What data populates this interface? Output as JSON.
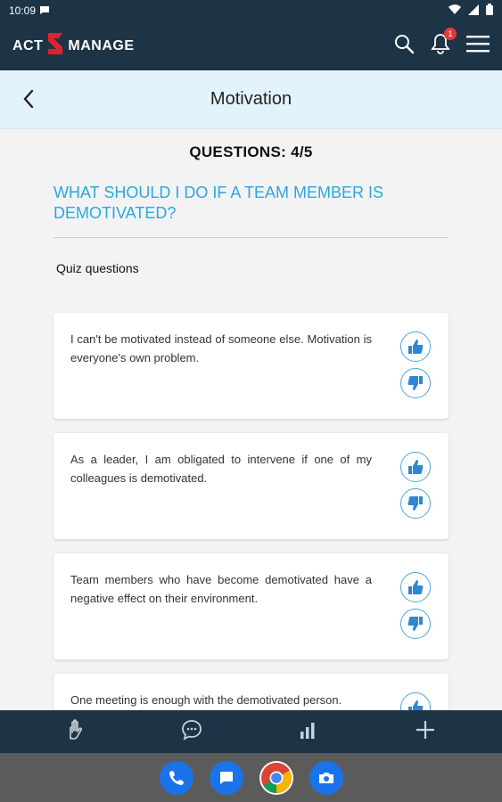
{
  "status": {
    "time": "10:09"
  },
  "app": {
    "logo_left": "ACT",
    "logo_right": "MANAGE",
    "notification_count": "1"
  },
  "page": {
    "title": "Motivation"
  },
  "quiz": {
    "progress": "QUESTIONS: 4/5",
    "question": "WHAT SHOULD I DO IF A TEAM MEMBER IS DEMOTIVATED?",
    "section_label": "Quiz questions",
    "answers": [
      {
        "text": "I can't be motivated instead of someone else. Motivation is everyone's own problem."
      },
      {
        "text": "As a leader, I am obligated to intervene if one of my colleagues is demotivated."
      },
      {
        "text": "Team members who have become demotivated have a negative effect on their environment."
      },
      {
        "text": "One meeting is enough with the demotivated person."
      }
    ]
  },
  "colors": {
    "header": "#1d3447",
    "title_bar": "#e3f3fc",
    "accent": "#29a8e0",
    "vote_blue": "#4aa6e0"
  },
  "icons": {
    "status": [
      "message-icon",
      "wifi-icon",
      "signal-icon",
      "battery-icon"
    ],
    "appbar": [
      "search-icon",
      "bell-icon",
      "menu-icon"
    ],
    "bottomnav": [
      "hand-icon",
      "chat-icon",
      "stats-icon",
      "add-icon"
    ],
    "dock": [
      "phone-icon",
      "messages-icon",
      "chrome-icon",
      "camera-icon"
    ]
  }
}
